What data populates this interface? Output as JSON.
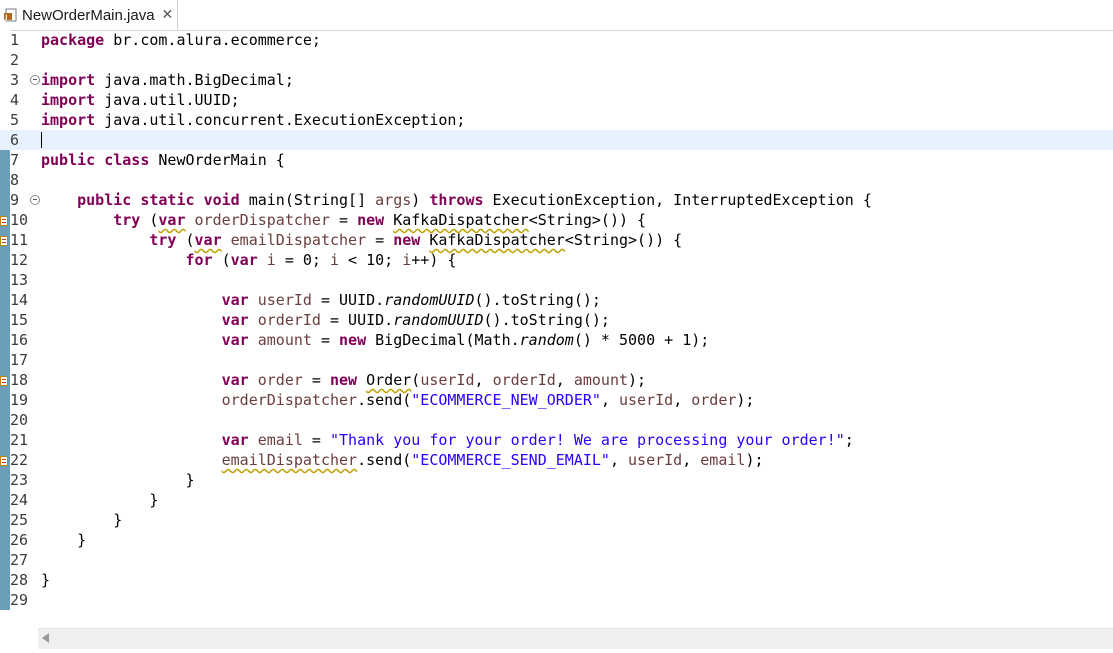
{
  "tab": {
    "label": "NewOrderMain.java",
    "close_glyph": "✕",
    "icon": "java-file-icon"
  },
  "lines": [
    {
      "n": "1"
    },
    {
      "n": "2"
    },
    {
      "n": "3"
    },
    {
      "n": "4"
    },
    {
      "n": "5"
    },
    {
      "n": "6"
    },
    {
      "n": "7"
    },
    {
      "n": "8"
    },
    {
      "n": "9"
    },
    {
      "n": "10"
    },
    {
      "n": "11"
    },
    {
      "n": "12"
    },
    {
      "n": "13"
    },
    {
      "n": "14"
    },
    {
      "n": "15"
    },
    {
      "n": "16"
    },
    {
      "n": "17"
    },
    {
      "n": "18"
    },
    {
      "n": "19"
    },
    {
      "n": "20"
    },
    {
      "n": "21"
    },
    {
      "n": "22"
    },
    {
      "n": "23"
    },
    {
      "n": "24"
    },
    {
      "n": "25"
    },
    {
      "n": "26"
    },
    {
      "n": "27"
    },
    {
      "n": "28"
    },
    {
      "n": "29"
    }
  ],
  "code": {
    "l1": {
      "kw": "package",
      "rest": " br.com.alura.ecommerce;"
    },
    "l3": {
      "kw": "import",
      "rest": " java.math.BigDecimal;"
    },
    "l4": {
      "kw": "import",
      "rest": " java.util.UUID;"
    },
    "l5": {
      "kw": "import",
      "rest": " java.util.concurrent.ExecutionException;"
    },
    "l7": {
      "kw1": "public",
      "kw2": "class",
      "rest": " NewOrderMain {"
    },
    "l9": {
      "kw1": "public",
      "kw2": "static",
      "kw3": "void",
      "a": " main(String[] ",
      "args": "args",
      "b": ") ",
      "kw4": "throws",
      "c": " ExecutionException, InterruptedException {"
    },
    "l10": {
      "kw": "try",
      "a": " (",
      "var": "var",
      "b": " ",
      "name": "orderDispatcher",
      "c": " = ",
      "new": "new",
      "d": " ",
      "cls": "KafkaDispatcher",
      "e": "<String>()) {"
    },
    "l11": {
      "kw": "try",
      "a": " (",
      "var": "var",
      "b": " ",
      "name": "emailDispatcher",
      "c": " = ",
      "new": "new",
      "d": " ",
      "cls": "KafkaDispatcher",
      "e": "<String>()) {"
    },
    "l12": {
      "kw": "for",
      "a": " (",
      "var": "var",
      "b": " ",
      "i": "i",
      "c": " = 0; ",
      "i2": "i",
      "d": " < 10; ",
      "i3": "i",
      "e": "++) {"
    },
    "l14": {
      "var": "var",
      "b": " ",
      "name": "userId",
      "c": " = UUID.",
      "m": "randomUUID",
      "d": "().toString();"
    },
    "l15": {
      "var": "var",
      "b": " ",
      "name": "orderId",
      "c": " = UUID.",
      "m": "randomUUID",
      "d": "().toString();"
    },
    "l16": {
      "var": "var",
      "b": " ",
      "name": "amount",
      "c": " = ",
      "new": "new",
      "d": " BigDecimal(Math.",
      "m": "random",
      "e": "() * 5000 + 1);"
    },
    "l18": {
      "var": "var",
      "b": " ",
      "name": "order",
      "c": " = ",
      "new": "new",
      "d": " ",
      "cls": "Order",
      "e": "(",
      "v1": "userId",
      "f": ", ",
      "v2": "orderId",
      "g": ", ",
      "v3": "amount",
      "h": ");"
    },
    "l19": {
      "v0": "orderDispatcher",
      "a": ".send(",
      "s": "\"ECOMMERCE_NEW_ORDER\"",
      "b": ", ",
      "v1": "userId",
      "c": ", ",
      "v2": "order",
      "d": ");"
    },
    "l21": {
      "var": "var",
      "b": " ",
      "name": "email",
      "c": " = ",
      "s": "\"Thank you for your order! We are processing your order!\"",
      "d": ";"
    },
    "l22": {
      "v0": "emailDispatcher",
      "a": ".send(",
      "s": "\"ECOMMERCE_SEND_EMAIL\"",
      "b": ", ",
      "v1": "userId",
      "c": ", ",
      "v2": "email",
      "d": ");"
    },
    "l23": "}",
    "l24": "}",
    "l25": "}",
    "l26": "}",
    "l28": "}"
  },
  "colors": {
    "keyword": "#7f0055",
    "string": "#2a00ff",
    "local_variable": "#6a3e3e",
    "current_line": "#e8f2fe",
    "change_bar": "#6b9eb8"
  }
}
